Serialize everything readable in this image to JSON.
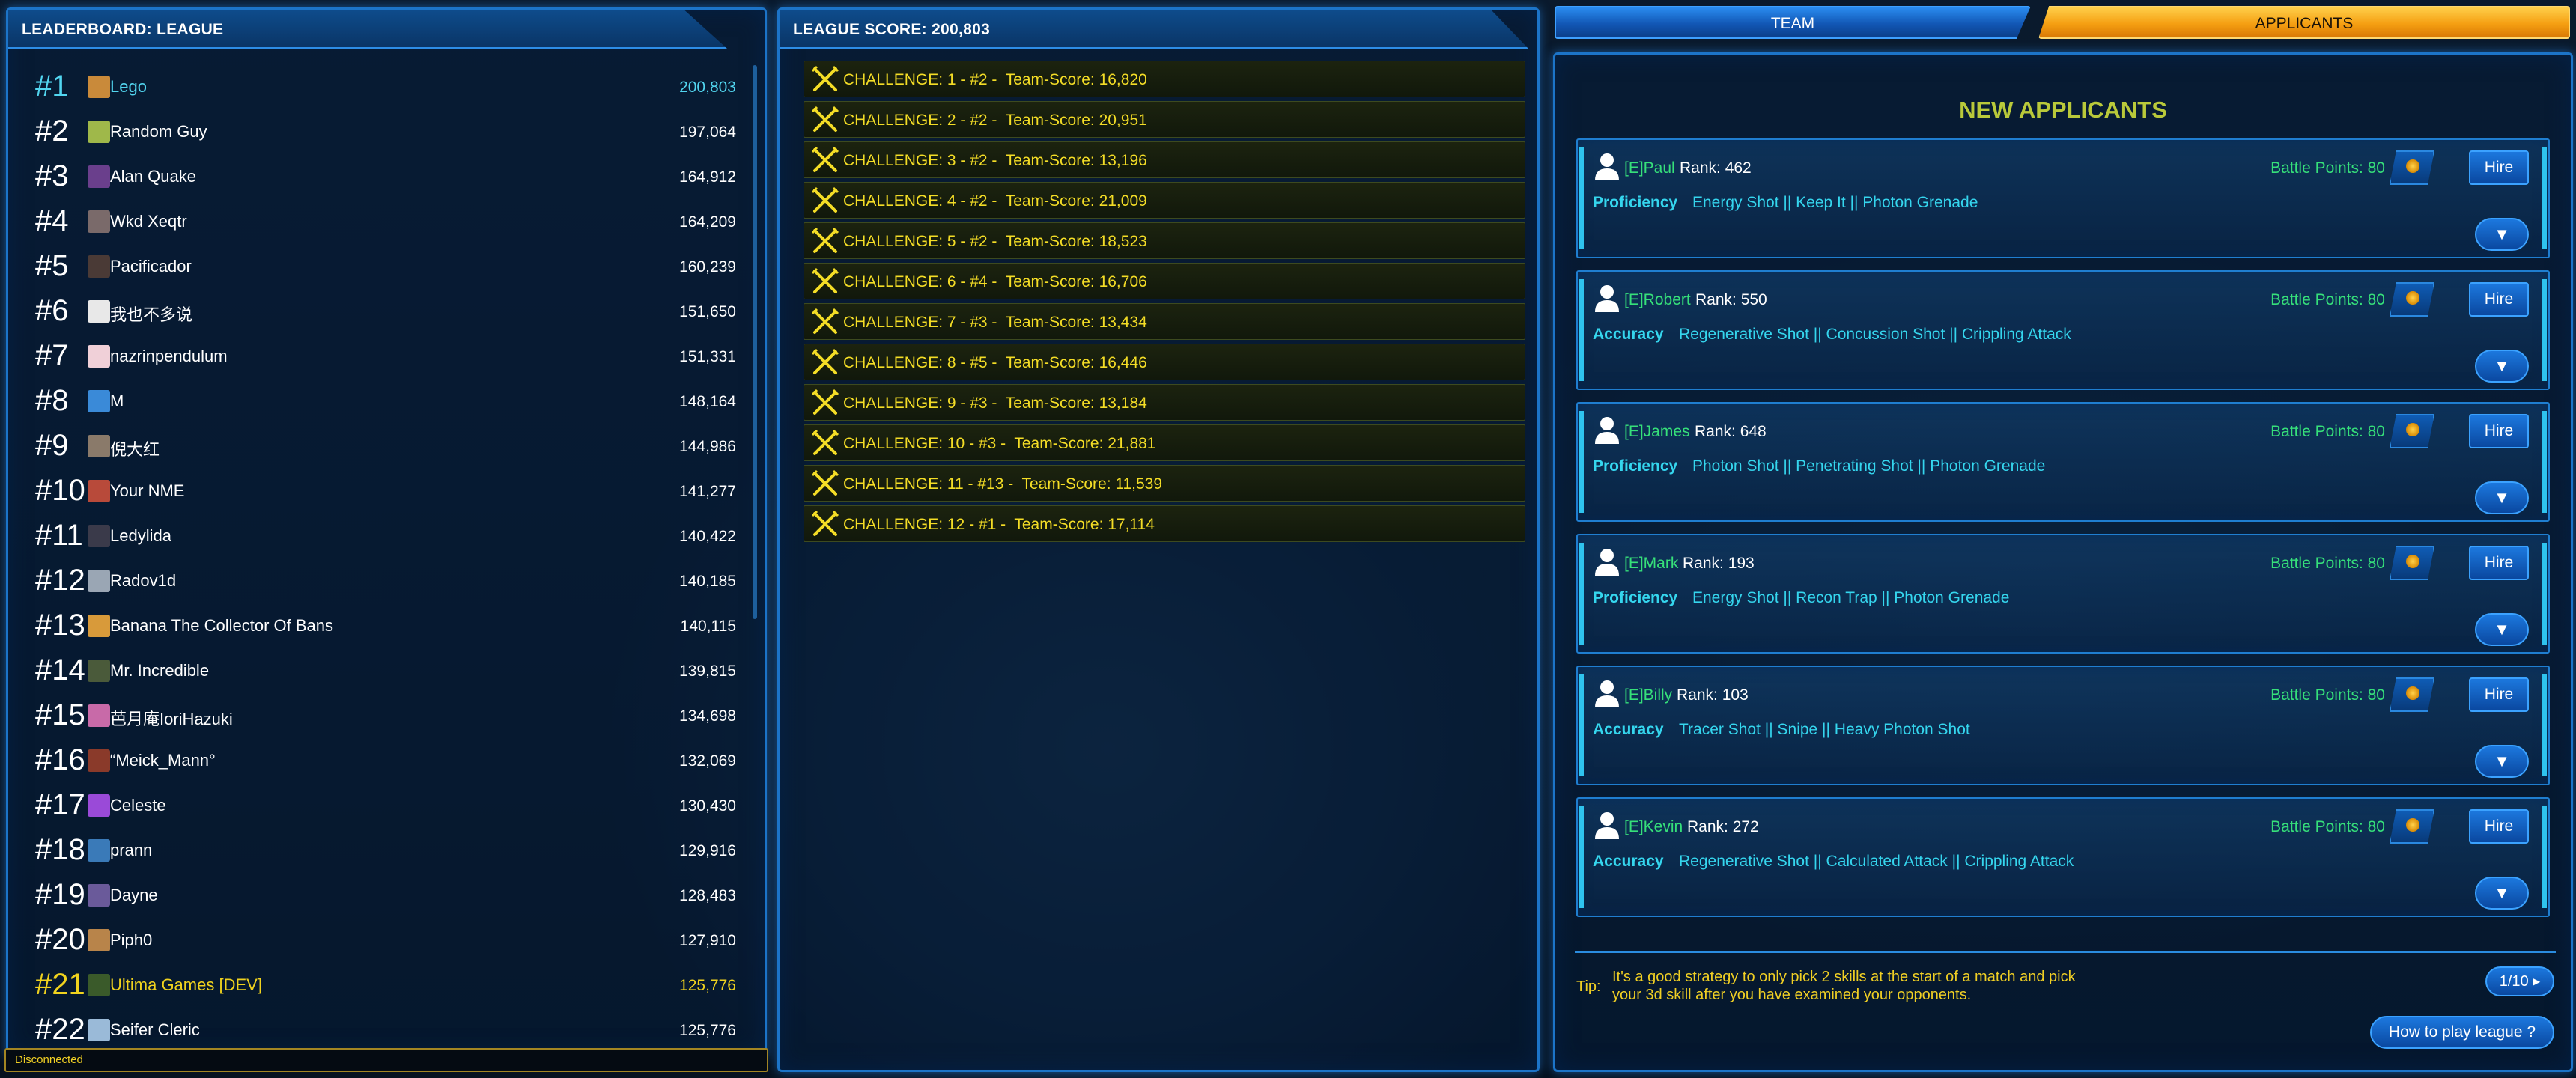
{
  "leaderboard": {
    "title": "LEADERBOARD: LEAGUE",
    "rows": [
      {
        "rank": "#1",
        "name": "Lego",
        "score": "200,803",
        "avatar_color": "#c98a3a",
        "style": "first"
      },
      {
        "rank": "#2",
        "name": "Random Guy",
        "score": "197,064",
        "avatar_color": "#9fb84a",
        "style": ""
      },
      {
        "rank": "#3",
        "name": "Alan Quake",
        "score": "164,912",
        "avatar_color": "#6a3f8c",
        "style": ""
      },
      {
        "rank": "#4",
        "name": "Wkd Xeqtr",
        "score": "164,209",
        "avatar_color": "#7a6a6a",
        "style": ""
      },
      {
        "rank": "#5",
        "name": "Pacificador",
        "score": "160,239",
        "avatar_color": "#4a3a36",
        "style": ""
      },
      {
        "rank": "#6",
        "name": "我也不多说",
        "score": "151,650",
        "avatar_color": "#e8e8e8",
        "style": ""
      },
      {
        "rank": "#7",
        "name": "nazrinpendulum",
        "score": "151,331",
        "avatar_color": "#f0d0d8",
        "style": ""
      },
      {
        "rank": "#8",
        "name": "M",
        "score": "148,164",
        "avatar_color": "#3a8ad8",
        "style": ""
      },
      {
        "rank": "#9",
        "name": "倪大红",
        "score": "144,986",
        "avatar_color": "#8a7a6a",
        "style": ""
      },
      {
        "rank": "#10",
        "name": "Your NME",
        "score": "141,277",
        "avatar_color": "#b84a3a",
        "style": ""
      },
      {
        "rank": "#11",
        "name": "Ledylida",
        "score": "140,422",
        "avatar_color": "#3a3a4a",
        "style": ""
      },
      {
        "rank": "#12",
        "name": "Radov1d",
        "score": "140,185",
        "avatar_color": "#9aa6b4",
        "style": ""
      },
      {
        "rank": "#13",
        "name": "Banana The Collector Of Bans",
        "score": "140,115",
        "avatar_color": "#d89a3a",
        "style": ""
      },
      {
        "rank": "#14",
        "name": "Mr. Incredible",
        "score": "139,815",
        "avatar_color": "#4a5a3a",
        "style": ""
      },
      {
        "rank": "#15",
        "name": "芭月庵IoriHazuki",
        "score": "134,698",
        "avatar_color": "#c86aa8",
        "style": ""
      },
      {
        "rank": "#16",
        "name": "“Meick_Mann°",
        "score": "132,069",
        "avatar_color": "#8a3a2a",
        "style": ""
      },
      {
        "rank": "#17",
        "name": "Celeste",
        "score": "130,430",
        "avatar_color": "#9a4ad8",
        "style": ""
      },
      {
        "rank": "#18",
        "name": "prann",
        "score": "129,916",
        "avatar_color": "#3a7ab8",
        "style": ""
      },
      {
        "rank": "#19",
        "name": "Dayne",
        "score": "128,483",
        "avatar_color": "#6a5a9a",
        "style": ""
      },
      {
        "rank": "#20",
        "name": "Piph0",
        "score": "127,910",
        "avatar_color": "#b8844a",
        "style": ""
      },
      {
        "rank": "#21",
        "name": "Ultima Games [DEV]",
        "score": "125,776",
        "avatar_color": "#3a5a2a",
        "style": "dev"
      },
      {
        "rank": "#22",
        "name": "Seifer Cleric",
        "score": "125,776",
        "avatar_color": "#9abad8",
        "style": ""
      }
    ]
  },
  "status": {
    "text": "Disconnected"
  },
  "league": {
    "title": "LEAGUE SCORE: 200,803",
    "challenges": [
      "CHALLENGE: 1 - #2 -  Team-Score: 16,820",
      "CHALLENGE: 2 - #2 -  Team-Score: 20,951",
      "CHALLENGE: 3 - #2 -  Team-Score: 13,196",
      "CHALLENGE: 4 - #2 -  Team-Score: 21,009",
      "CHALLENGE: 5 - #2 -  Team-Score: 18,523",
      "CHALLENGE: 6 - #4 -  Team-Score: 16,706",
      "CHALLENGE: 7 - #3 -  Team-Score: 13,434",
      "CHALLENGE: 8 - #5 -  Team-Score: 16,446",
      "CHALLENGE: 9 - #3 -  Team-Score: 13,184",
      "CHALLENGE: 10 - #3 -  Team-Score: 21,881",
      "CHALLENGE: 11 - #13 -  Team-Score: 11,539",
      "CHALLENGE: 12 - #1 -  Team-Score: 17,114"
    ]
  },
  "tabs": {
    "team": "TEAM",
    "applicants": "APPLICANTS",
    "active": "applicants"
  },
  "applicants": {
    "title": "NEW APPLICANTS",
    "hire_label": "Hire",
    "expand_label": "▼",
    "list": [
      {
        "name": "[E]Paul",
        "rank": "Rank: 462",
        "battle_points": "Battle Points: 80",
        "type": "Proficiency",
        "skills": "Energy Shot || Keep It || Photon Grenade"
      },
      {
        "name": "[E]Robert",
        "rank": "Rank: 550",
        "battle_points": "Battle Points: 80",
        "type": "Accuracy",
        "skills": "Regenerative Shot || Concussion Shot || Crippling Attack"
      },
      {
        "name": "[E]James",
        "rank": "Rank: 648",
        "battle_points": "Battle Points: 80",
        "type": "Proficiency",
        "skills": "Photon Shot || Penetrating Shot || Photon Grenade"
      },
      {
        "name": "[E]Mark",
        "rank": "Rank: 193",
        "battle_points": "Battle Points: 80",
        "type": "Proficiency",
        "skills": "Energy Shot || Recon Trap || Photon Grenade"
      },
      {
        "name": "[E]Billy",
        "rank": "Rank: 103",
        "battle_points": "Battle Points: 80",
        "type": "Accuracy",
        "skills": "Tracer Shot || Snipe || Heavy Photon Shot"
      },
      {
        "name": "[E]Kevin",
        "rank": "Rank: 272",
        "battle_points": "Battle Points: 80",
        "type": "Accuracy",
        "skills": "Regenerative Shot || Calculated Attack || Crippling Attack"
      }
    ],
    "tip_label": "Tip:",
    "tip_text": "It's a good strategy to only pick 2 skills at the start of a match and pick your 3d skill after you have examined your opponents.",
    "page_label": "1/10 ▸",
    "howto_label": "How to play league ?"
  },
  "colors": {
    "accent_blue": "#1c74c8",
    "highlight_cyan": "#52d6f0",
    "dev_yellow": "#f0d21e",
    "name_green": "#36e07a",
    "tab_orange": "#f59f12"
  }
}
